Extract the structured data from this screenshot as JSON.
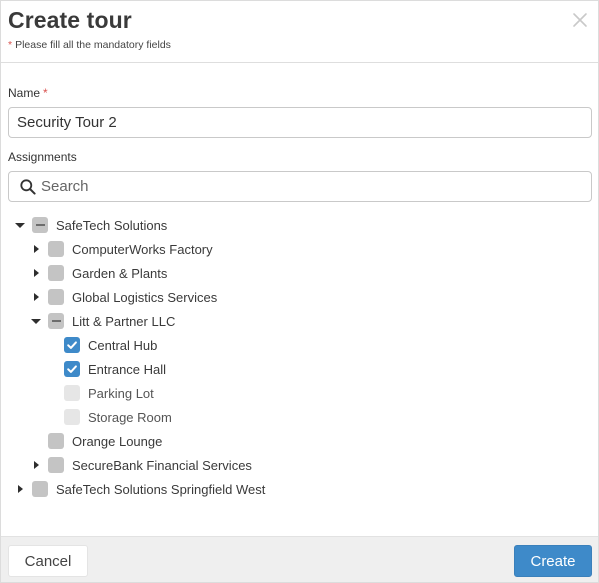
{
  "dialog": {
    "title": "Create tour",
    "mandatory_marker": "*",
    "mandatory_note": "Please fill all the mandatory fields"
  },
  "name_field": {
    "label": "Name",
    "required_marker": "*",
    "value": "Security Tour 2"
  },
  "assignments": {
    "label": "Assignments",
    "search_placeholder": "Search"
  },
  "tree": [
    {
      "label": "SafeTech Solutions",
      "level": 0,
      "caret": "down",
      "state": "indeterminate"
    },
    {
      "label": "ComputerWorks Factory",
      "level": 1,
      "caret": "right",
      "state": "unchecked"
    },
    {
      "label": "Garden & Plants",
      "level": 1,
      "caret": "right",
      "state": "unchecked"
    },
    {
      "label": "Global Logistics Services",
      "level": 1,
      "caret": "right",
      "state": "unchecked"
    },
    {
      "label": "Litt & Partner LLC",
      "level": 1,
      "caret": "down",
      "state": "indeterminate"
    },
    {
      "label": "Central Hub",
      "level": 2,
      "caret": "none",
      "state": "checked"
    },
    {
      "label": "Entrance Hall",
      "level": 2,
      "caret": "none",
      "state": "checked"
    },
    {
      "label": "Parking Lot",
      "level": 2,
      "caret": "none",
      "state": "disabled"
    },
    {
      "label": "Storage Room",
      "level": 2,
      "caret": "none",
      "state": "disabled"
    },
    {
      "label": "Orange Lounge",
      "level": 1,
      "caret": "none",
      "state": "unchecked"
    },
    {
      "label": "SecureBank Financial Services",
      "level": 1,
      "caret": "right",
      "state": "unchecked"
    },
    {
      "label": "SafeTech Solutions Springfield West",
      "level": 0,
      "caret": "right",
      "state": "unchecked"
    }
  ],
  "footer": {
    "cancel_label": "Cancel",
    "create_label": "Create"
  },
  "colors": {
    "accent": "#3e8ac9",
    "required": "#d9534f",
    "checkbox_unchecked": "#c4c4c4",
    "checkbox_disabled": "#e6e6e6"
  },
  "icons": {
    "close": "close-icon",
    "search": "search-icon",
    "check": "check-icon",
    "expand": "caret-right-icon",
    "collapse": "caret-down-icon"
  }
}
